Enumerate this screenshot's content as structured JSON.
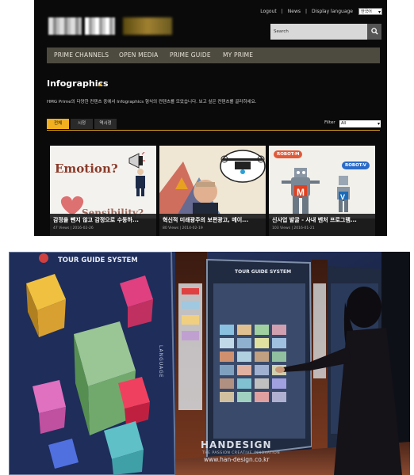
{
  "header": {
    "top_links": [
      "Logout",
      "|",
      "News",
      "|",
      "Display language"
    ],
    "language_value": "한국어",
    "search_placeholder": "Search",
    "search_icon": "magnifier"
  },
  "nav": {
    "items": [
      "PRIME CHANNELS",
      "OPEN MEDIA",
      "PRIME GUIDE",
      "MY PRIME"
    ]
  },
  "page": {
    "title": "Infographics",
    "description": "HMG Prime의 다양한 컨텐츠 중에서 Infographics 형식의 컨텐츠를 모았습니다. 보고 싶은 컨텐츠를 골라하세요.",
    "tabs": [
      "전체",
      "시정",
      "역시정"
    ],
    "active_tab": 0,
    "filter_label": "Filter",
    "filter_value": "All"
  },
  "cards": [
    {
      "title": "감정을 뺀지 않고 감정으로 수동하...",
      "meta": "47 Views | 2016-02-26",
      "image_text_1": "Emotion?",
      "image_text_2": "Sensibility?"
    },
    {
      "title": "혁신적 미래광주의 보편광고, 메이...",
      "meta": "80 Views | 2014-02-19"
    },
    {
      "title": "신사업 발굴 - 사내 벤처 프로그램...",
      "meta": "103 Views | 2016-01-21",
      "badge_left": "ROBOT-M",
      "badge_right": "ROBOT-V"
    }
  ],
  "photo": {
    "left_screen_title": "TOUR GUIDE SYSTEM",
    "mid_screen_title": "TOUR GUIDE SYSTEM",
    "vertical_label": "LANGUAGE",
    "brand": "HANDESIGN",
    "brand_sub": "THE PASSION CREATIVE INNOVATION",
    "url": "www.han-design.co.kr"
  },
  "colors": {
    "accent": "#f0b020",
    "nav_bg": "#4d4a40",
    "page_bg": "#0a0a0a"
  }
}
